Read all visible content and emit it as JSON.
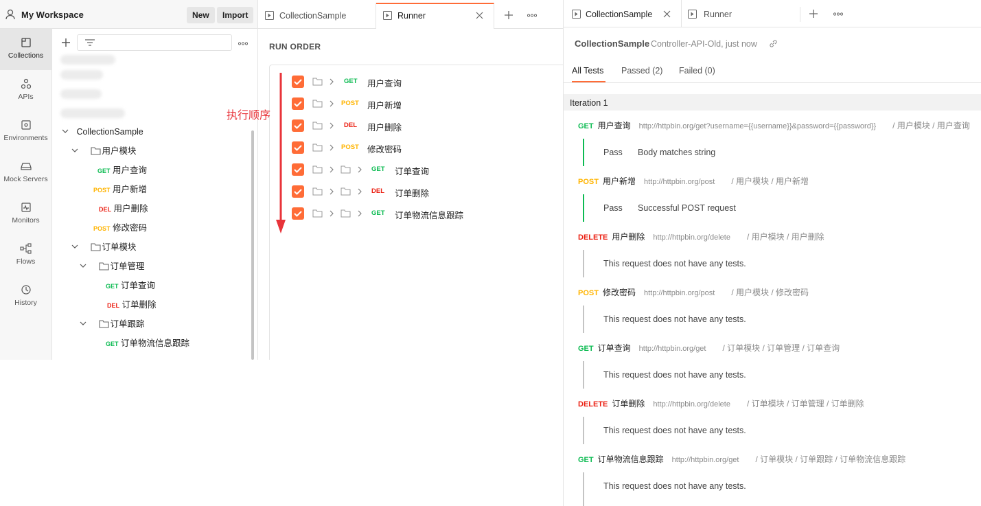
{
  "workspace": {
    "title": "My Workspace",
    "new_label": "New",
    "import_label": "Import"
  },
  "rail": [
    {
      "label": "Collections",
      "icon": "collections-icon"
    },
    {
      "label": "APIs",
      "icon": "apis-icon"
    },
    {
      "label": "Environments",
      "icon": "environments-icon"
    },
    {
      "label": "Mock Servers",
      "icon": "mock-servers-icon"
    },
    {
      "label": "Monitors",
      "icon": "monitors-icon"
    },
    {
      "label": "Flows",
      "icon": "flows-icon"
    },
    {
      "label": "History",
      "icon": "history-icon"
    }
  ],
  "tree": {
    "collection": "CollectionSample",
    "folder_user": "用户模块",
    "user_items": [
      {
        "method": "GET",
        "name": "用户查询"
      },
      {
        "method": "POST",
        "name": "用户新增"
      },
      {
        "method": "DEL",
        "name": "用户删除"
      },
      {
        "method": "POST",
        "name": "修改密码"
      }
    ],
    "folder_order": "订单模块",
    "folder_order_mgmt": "订单管理",
    "order_mgmt_items": [
      {
        "method": "GET",
        "name": "订单查询"
      },
      {
        "method": "DEL",
        "name": "订单删除"
      }
    ],
    "folder_order_track": "订单跟踪",
    "order_track_items": [
      {
        "method": "GET",
        "name": "订单物流信息跟踪"
      }
    ]
  },
  "mid_tabs": [
    {
      "label": "CollectionSample"
    },
    {
      "label": "Runner"
    }
  ],
  "run_order": {
    "title": "RUN ORDER",
    "annotation": "执行顺序",
    "rows": [
      {
        "method": "GET",
        "name": "用户查询"
      },
      {
        "method": "POST",
        "name": "用户新增"
      },
      {
        "method": "DEL",
        "name": "用户删除"
      },
      {
        "method": "POST",
        "name": "修改密码"
      },
      {
        "method": "GET",
        "name": "订单查询"
      },
      {
        "method": "DEL",
        "name": "订单删除"
      },
      {
        "method": "GET",
        "name": "订单物流信息跟踪"
      }
    ]
  },
  "right_tabs": [
    {
      "label": "CollectionSample"
    },
    {
      "label": "Runner"
    }
  ],
  "results": {
    "collection": "CollectionSample",
    "meta": "Controller-API-Old, just now",
    "tabs": {
      "all": "All Tests",
      "passed": "Passed (2)",
      "failed": "Failed (0)"
    },
    "iteration": "Iteration 1",
    "requests": [
      {
        "method": "GET",
        "name": "用户查询",
        "url": "http://httpbin.org/get?username={{username}}&password={{password}}",
        "path": "/ 用户模块 / 用户查询",
        "status": "Pass",
        "message": "Body matches string"
      },
      {
        "method": "POST",
        "name": "用户新增",
        "url": "http://httpbin.org/post",
        "path": "/ 用户模块 / 用户新增",
        "status": "Pass",
        "message": "Successful POST request"
      },
      {
        "method": "DELETE",
        "name": "用户删除",
        "url": "http://httpbin.org/delete",
        "path": "/ 用户模块 / 用户删除",
        "status": "",
        "message": "This request does not have any tests."
      },
      {
        "method": "POST",
        "name": "修改密码",
        "url": "http://httpbin.org/post",
        "path": "/ 用户模块 / 修改密码",
        "status": "",
        "message": "This request does not have any tests."
      },
      {
        "method": "GET",
        "name": "订单查询",
        "url": "http://httpbin.org/get",
        "path": "/ 订单模块 / 订单管理 / 订单查询",
        "status": "",
        "message": "This request does not have any tests."
      },
      {
        "method": "DELETE",
        "name": "订单删除",
        "url": "http://httpbin.org/delete",
        "path": "/ 订单模块 / 订单管理 / 订单删除",
        "status": "",
        "message": "This request does not have any tests."
      },
      {
        "method": "GET",
        "name": "订单物流信息跟踪",
        "url": "http://httpbin.org/get",
        "path": "/ 订单模块 / 订单跟踪 / 订单物流信息跟踪",
        "status": "",
        "message": "This request does not have any tests."
      }
    ]
  },
  "colors": {
    "get": "#0cbb52",
    "post": "#ffb400",
    "delete": "#eb2013",
    "accent": "#ff6c37",
    "annotation": "#e8343a"
  }
}
